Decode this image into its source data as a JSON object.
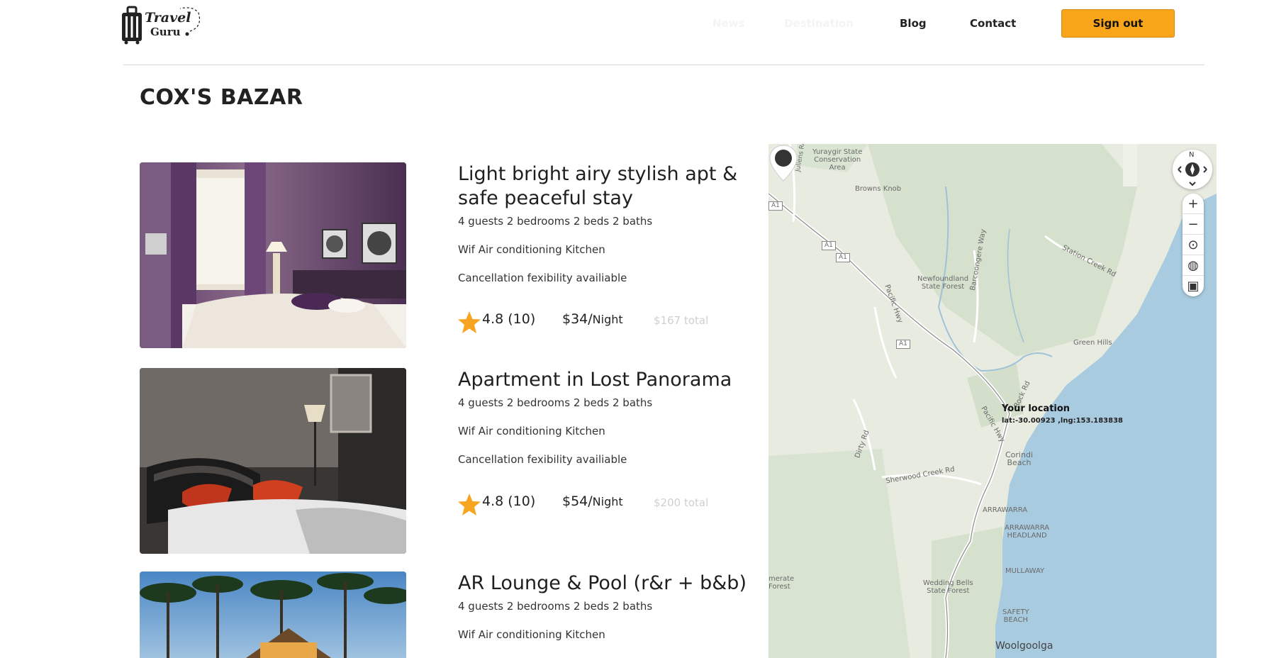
{
  "header": {
    "logo_line1": "Travel",
    "logo_line2": "Guru",
    "nav": [
      "News",
      "Destination",
      "Blog",
      "Contact"
    ],
    "signout_label": "Sign out"
  },
  "page_title": "COX'S BAZAR",
  "listings": [
    {
      "title": "Light bright airy stylish apt & safe peaceful stay",
      "details": "4 guests 2 bedrooms 2 beds 2 baths",
      "amenities": "Wif Air conditioning Kitchen",
      "cancellation": "Cancellation fexibility availiable",
      "rating": "4.8 (10)",
      "price": "$34/",
      "price_unit": "Night",
      "total": "$167 total"
    },
    {
      "title": "Apartment in Lost Panorama",
      "details": "4 guests 2 bedrooms 2 beds 2 baths",
      "amenities": "Wif Air conditioning Kitchen",
      "cancellation": "Cancellation fexibility availiable",
      "rating": "4.8 (10)",
      "price": "$54/",
      "price_unit": "Night",
      "total": "$200 total"
    },
    {
      "title": "AR Lounge & Pool (r&r + b&b)",
      "details": "4 guests 2 bedrooms 2 beds 2 baths",
      "amenities": "Wif Air conditioning Kitchen"
    }
  ],
  "map": {
    "compass_n": "N",
    "pin_title": "Your location",
    "pin_coords": "lat:-30.00923 ,lng:153.183838",
    "labels": {
      "yuraygir": "Yuraygir State\nConservation\nArea",
      "browns_knob": "Browns Knob",
      "newfoundland": "Newfoundland\nState Forest",
      "barcoongere": "Barcoongere Way",
      "station_creek": "Station Creek Rd",
      "green_hills": "Green Hills",
      "pacific_hwy": "Pacific Hwy",
      "pacific_hwy2": "Pacific Hwy",
      "a1_1": "A1",
      "a1_2": "A1",
      "a1_3": "A1",
      "a1_4": "A1",
      "corindi": "Corindi\nBeach",
      "dirty_rd": "Dirty Rd",
      "sherwood": "Sherwood Creek Rd",
      "arrawarra": "ARRAWARRA",
      "arrawarra_headland": "ARRAWARRA\nHEADLAND",
      "mullaway": "MULLAWAY",
      "wedding_bells": "Wedding Bells\nState Forest",
      "safety_beach": "SAFETY\nBEACH",
      "woolgoolga": "Woolgoolga",
      "lower_forest": "merate\nForest",
      "rock_rd": "Rock Rd",
      "juliens": "Juliens Rd"
    }
  },
  "colors": {
    "accent": "#f9a51a",
    "star": "#f7a521",
    "sea": "#a9cbe0",
    "land": "#e8ebe0",
    "forest": "#d3dfcb"
  }
}
